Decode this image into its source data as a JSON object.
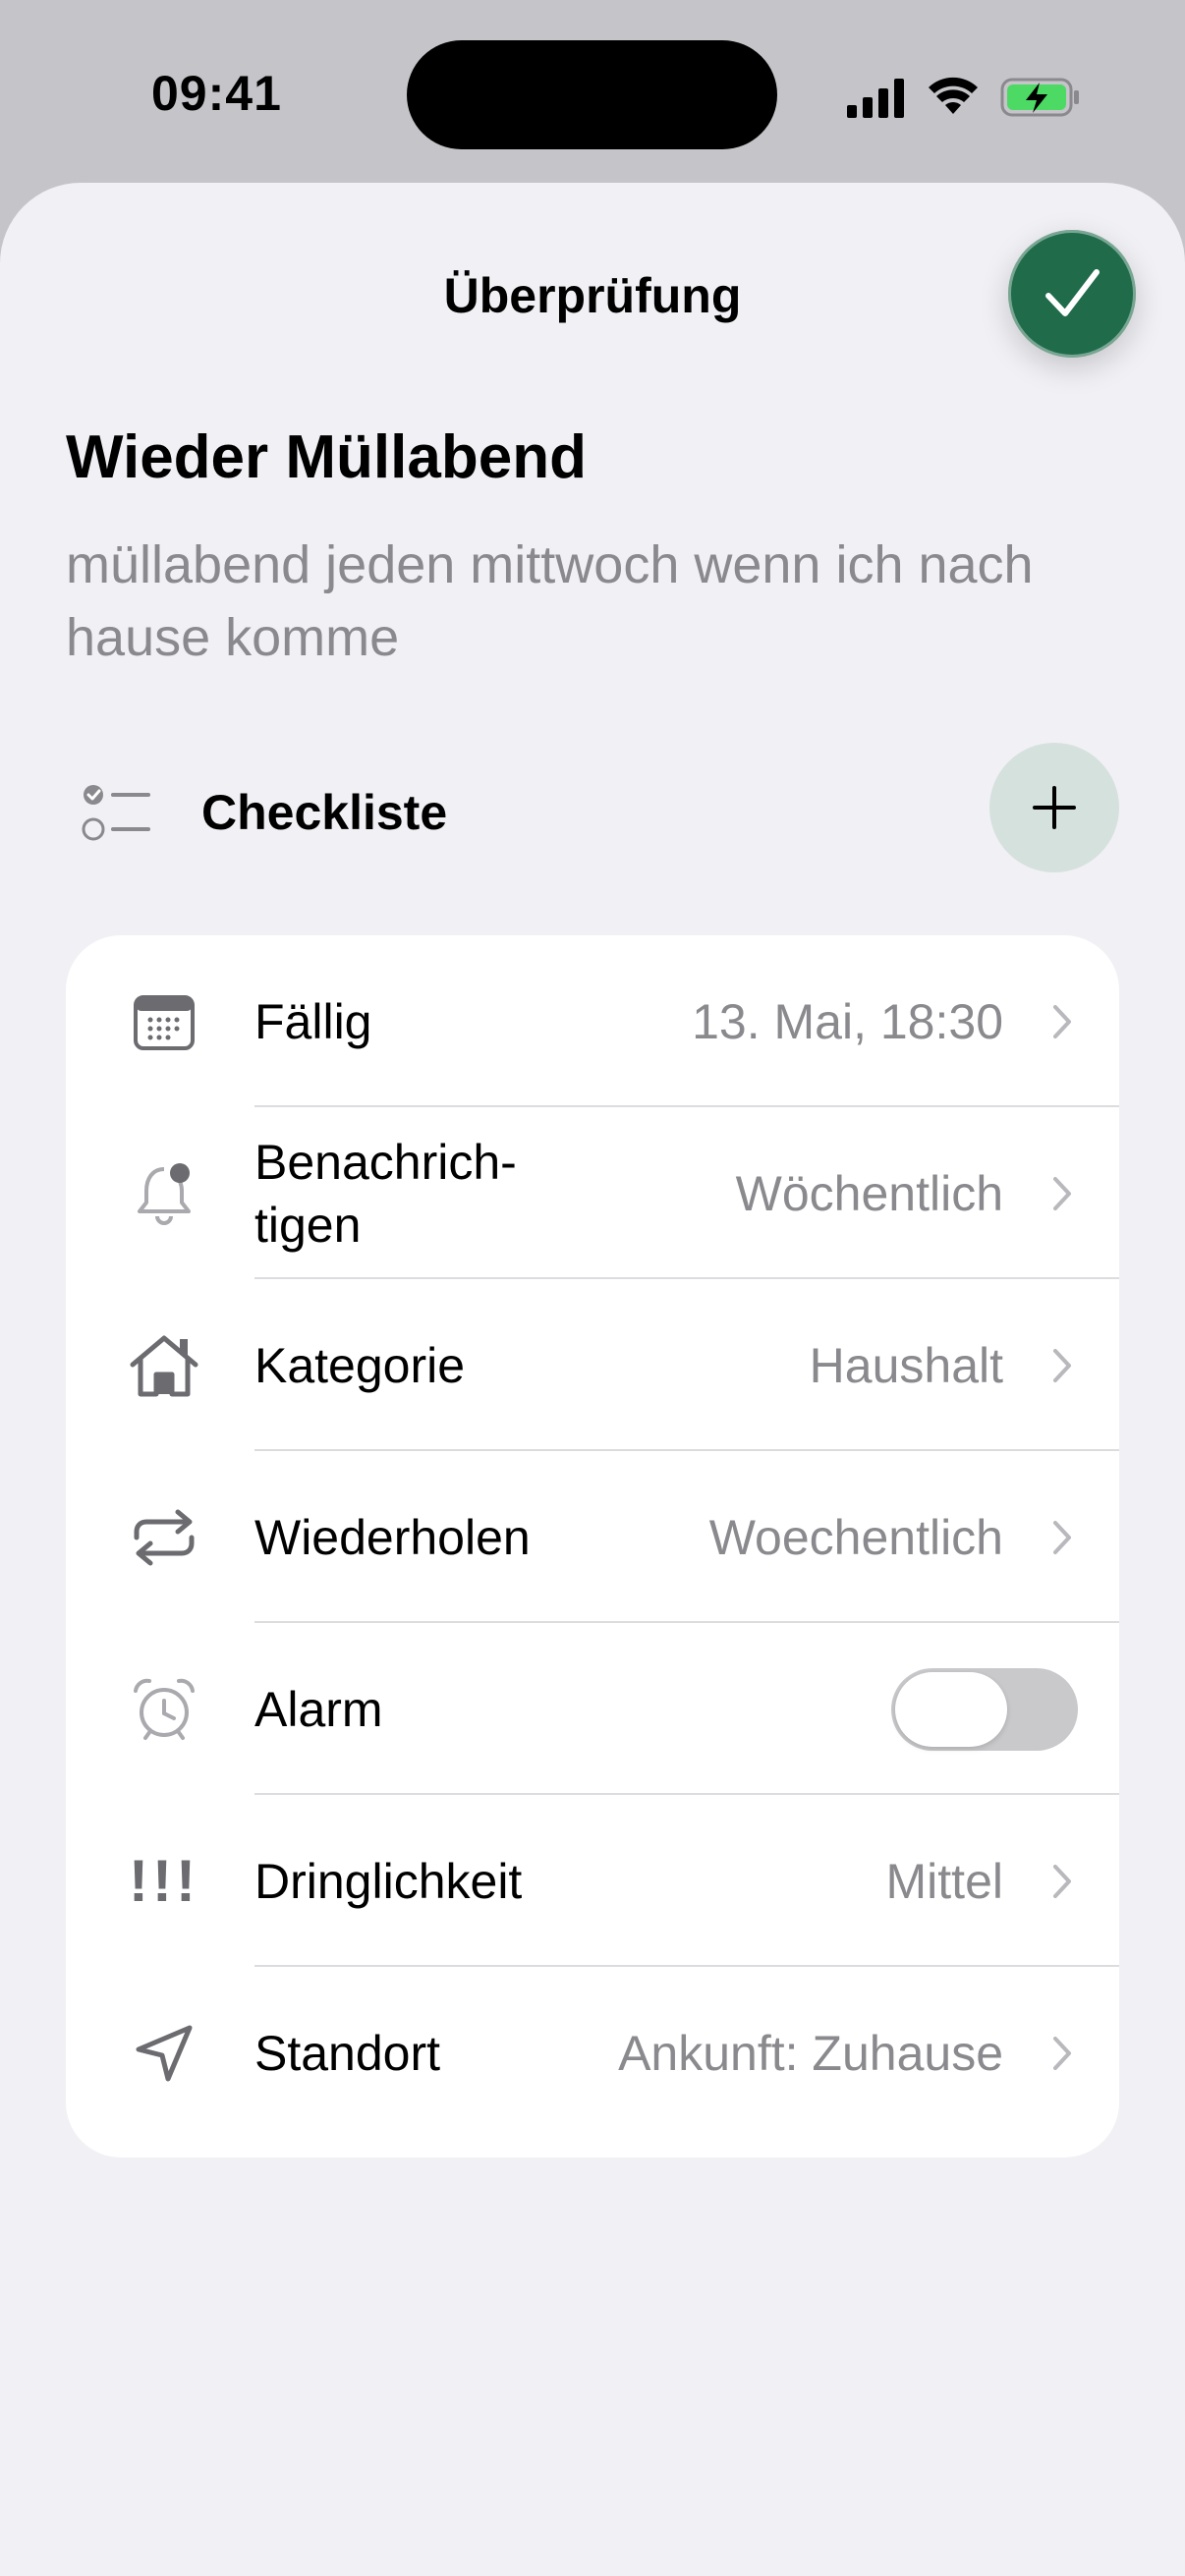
{
  "status_bar": {
    "time": "09:41",
    "icons": [
      "signal-icon",
      "wifi-icon",
      "battery-charging-icon"
    ],
    "battery_color": "#4cd964"
  },
  "sheet": {
    "title": "Überprüfung",
    "done_icon": "checkmark-icon",
    "accent_color": "#1f6b4a"
  },
  "task": {
    "title": "Wieder Müllabend",
    "notes": "müllabend jeden mittwoch wenn ich nach hause komme"
  },
  "checklist": {
    "label": "Checkliste",
    "add_icon": "plus-icon"
  },
  "settings": {
    "rows": [
      {
        "icon": "calendar-icon",
        "label": "Fällig",
        "value": "13. Mai, 18:30"
      },
      {
        "icon": "bell-badge-icon",
        "label": "Benachrich-\ntigen",
        "value": "Wöchentlich"
      },
      {
        "icon": "house-icon",
        "label": "Kategorie",
        "value": "Haushalt"
      },
      {
        "icon": "repeat-icon",
        "label": "Wiederholen",
        "value": "Woechentlich"
      },
      {
        "icon": "alarm-icon",
        "label": "Alarm",
        "toggle_on": false
      },
      {
        "icon": "exclamation-icon",
        "label": "Dringlichkeit",
        "value": "Mittel",
        "glyph": "!!!"
      },
      {
        "icon": "location-arrow-icon",
        "label": "Standort",
        "value": "Ankunft: Zuhause"
      }
    ]
  }
}
